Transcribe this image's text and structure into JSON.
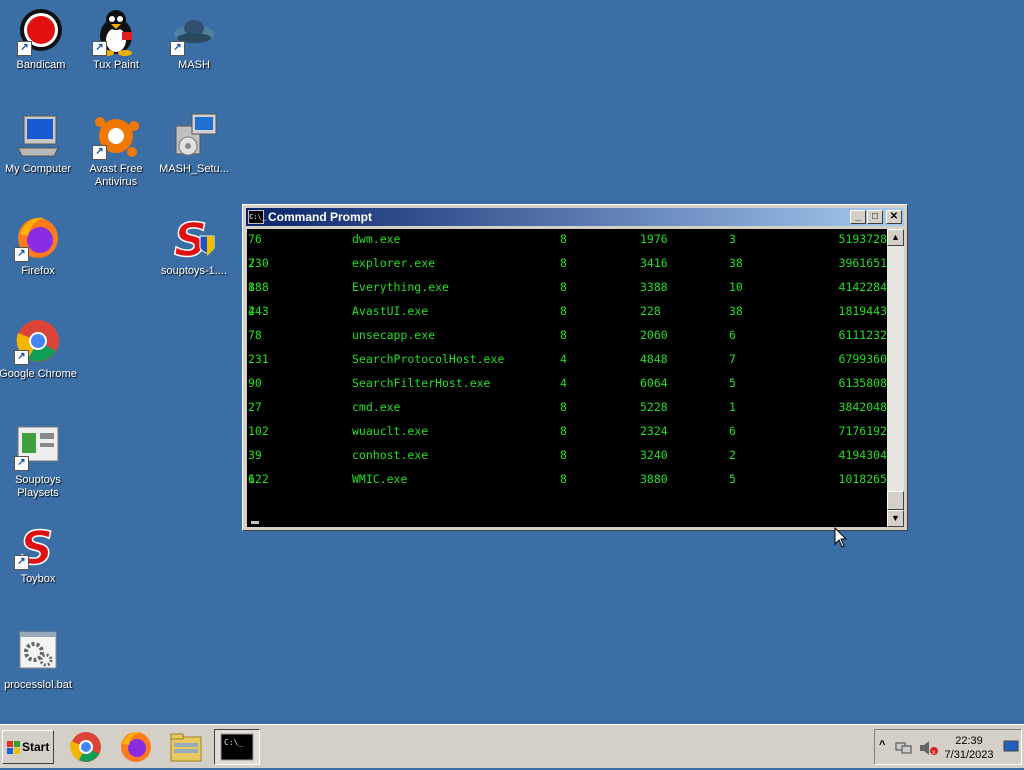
{
  "desktop": {
    "icons": [
      {
        "label": "Bandicam"
      },
      {
        "label": "Tux Paint"
      },
      {
        "label": "MASH"
      },
      {
        "label": "My Computer"
      },
      {
        "label": "Avast Free Antivirus"
      },
      {
        "label": "MASH_Setu..."
      },
      {
        "label": "Firefox"
      },
      {
        "label": "souptoys-1...."
      },
      {
        "label": "Google Chrome"
      },
      {
        "label": "Souptoys Playsets"
      },
      {
        "label": "Toybox"
      },
      {
        "label": "processlol.bat"
      }
    ]
  },
  "window": {
    "title": "Command Prompt",
    "icon_text": "C:\\_",
    "rows": [
      {
        "pid": "76",
        "name": "dwm.exe",
        "prio": "8",
        "ppid": "1976",
        "threads": "3",
        "mem": "5193728",
        "wrap": ""
      },
      {
        "pid": "730",
        "name": "explorer.exe",
        "prio": "8",
        "ppid": "3416",
        "threads": "38",
        "mem": "3961651",
        "wrap": "2"
      },
      {
        "pid": "188",
        "name": "Everything.exe",
        "prio": "8",
        "ppid": "3388",
        "threads": "10",
        "mem": "4142284",
        "wrap": "8"
      },
      {
        "pid": "443",
        "name": "AvastUI.exe",
        "prio": "8",
        "ppid": "228",
        "threads": "38",
        "mem": "1819443",
        "wrap": "2"
      },
      {
        "pid": "78",
        "name": "unsecapp.exe",
        "prio": "8",
        "ppid": "2060",
        "threads": "6",
        "mem": "6111232",
        "wrap": ""
      },
      {
        "pid": "231",
        "name": "SearchProtocolHost.exe",
        "prio": "4",
        "ppid": "4848",
        "threads": "7",
        "mem": "6799360",
        "wrap": ""
      },
      {
        "pid": "90",
        "name": "SearchFilterHost.exe",
        "prio": "4",
        "ppid": "6064",
        "threads": "5",
        "mem": "6135808",
        "wrap": ""
      },
      {
        "pid": "27",
        "name": "cmd.exe",
        "prio": "8",
        "ppid": "5228",
        "threads": "1",
        "mem": "3842048",
        "wrap": ""
      },
      {
        "pid": "102",
        "name": "wuauclt.exe",
        "prio": "8",
        "ppid": "2324",
        "threads": "6",
        "mem": "7176192",
        "wrap": ""
      },
      {
        "pid": "39",
        "name": "conhost.exe",
        "prio": "8",
        "ppid": "3240",
        "threads": "2",
        "mem": "4194304",
        "wrap": ""
      },
      {
        "pid": "122",
        "name": "WMIC.exe",
        "prio": "8",
        "ppid": "3880",
        "threads": "5",
        "mem": "1018265",
        "wrap": "6"
      }
    ]
  },
  "taskbar": {
    "start_label": "Start",
    "clock_time": "22:39",
    "clock_date": "7/31/2023"
  },
  "colors": {
    "desktop": "#3a6ea5",
    "console_text": "#22dd22",
    "titlebar": "#0a246a"
  }
}
